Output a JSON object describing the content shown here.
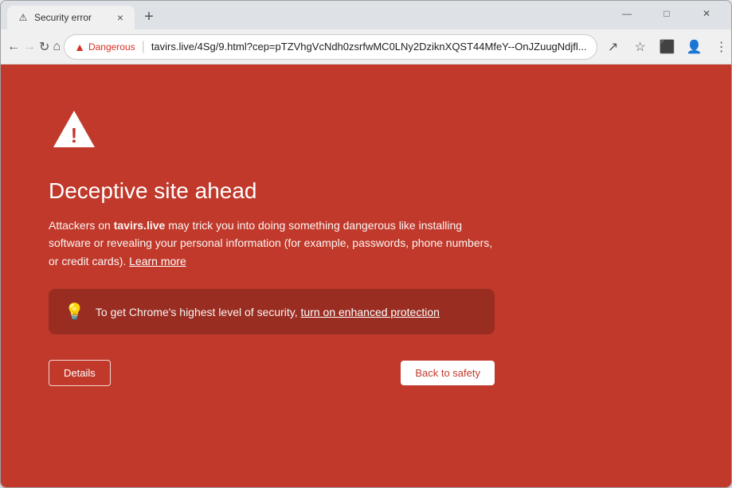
{
  "window": {
    "title": "Security error",
    "tab_favicon": "⚠",
    "tab_close": "×",
    "new_tab": "+"
  },
  "window_controls": {
    "minimize": "—",
    "maximize": "□",
    "close": "✕"
  },
  "nav": {
    "back": "←",
    "forward": "→",
    "reload": "↻",
    "home": "⌂",
    "security_label": "Dangerous",
    "separator": "|",
    "url": "tavirs.live/4Sg/9.html?cep=pTZVhgVcNdh0zsrfwMC0LNy2DziknXQST44MfeY--OnJZuugNdjfl...",
    "share_icon": "↗",
    "bookmark_icon": "☆",
    "extensions_icon": "⬛",
    "profile_icon": "👤",
    "menu_icon": "⋮"
  },
  "page": {
    "title": "Deceptive site ahead",
    "body_before_link": "Attackers on ",
    "site_name": "tavirs.live",
    "body_after_site": " may trick you into doing something dangerous like installing software or revealing your personal information (for example, passwords, phone numbers, or credit cards).",
    "learn_more_text": "Learn more",
    "ep_prefix": "To get Chrome's highest level of security, ",
    "ep_link": "turn on enhanced protection",
    "details_btn": "Details",
    "safety_btn": "Back to safety",
    "background_color": "#c0392b"
  }
}
